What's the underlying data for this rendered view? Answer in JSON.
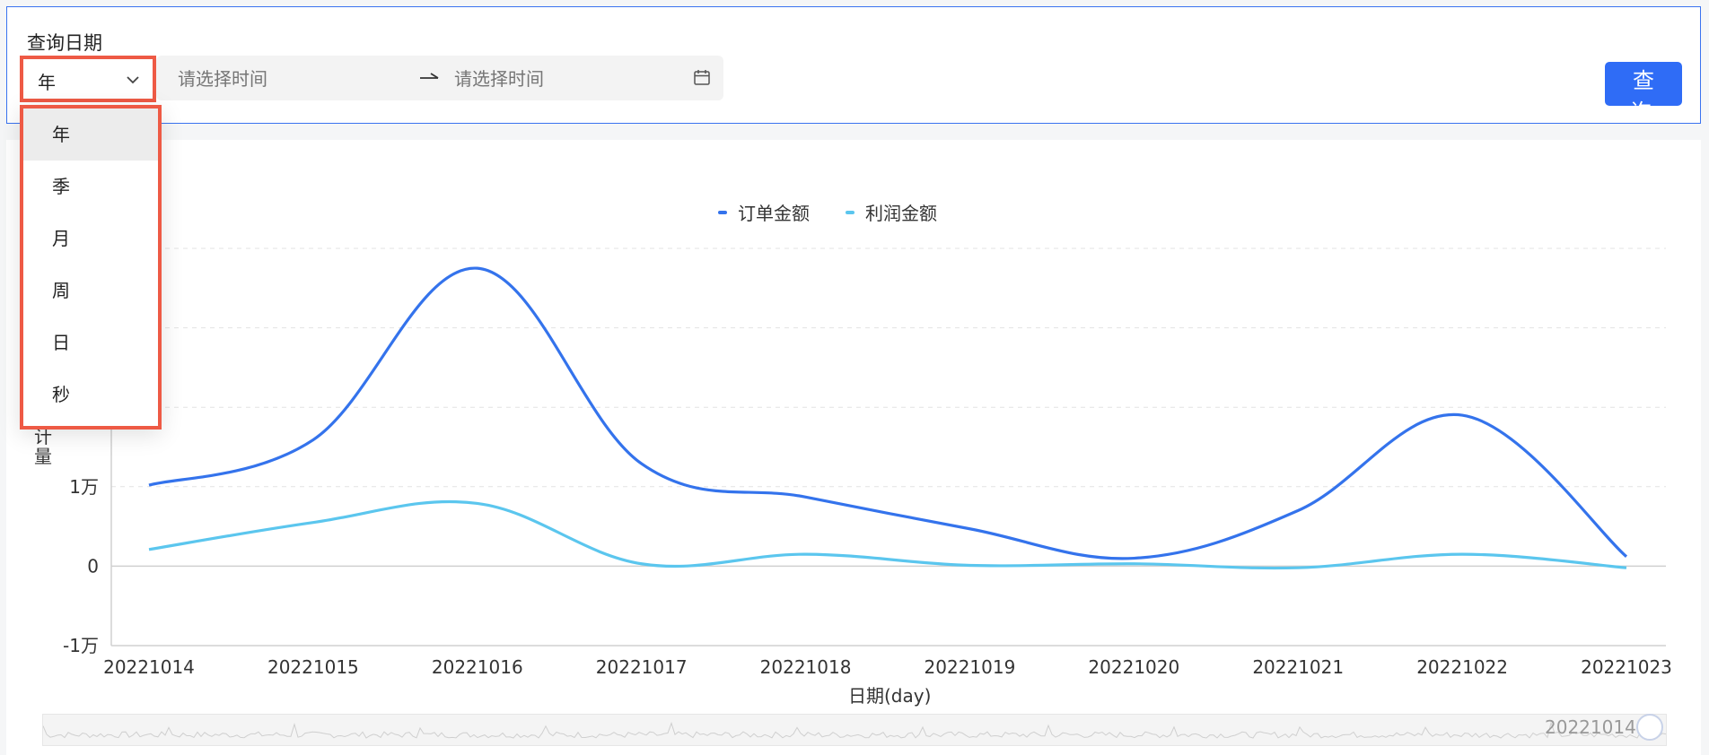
{
  "query": {
    "label": "查询日期",
    "granularity": "年",
    "start_placeholder": "请选择时间",
    "end_placeholder": "请选择时间",
    "submit_label": "查 询"
  },
  "dropdown": {
    "items": [
      "年",
      "季",
      "月",
      "周",
      "日",
      "秒"
    ],
    "active_index": 0
  },
  "colors": {
    "accent": "#2f6cf6",
    "highlight": "#ee5a45",
    "series_order": "#3473ec",
    "series_profit": "#5bc6ee"
  },
  "icons": {
    "select_arrow": "chevron-down-icon",
    "range_separator": "arrow-right-icon",
    "calendar": "calendar-icon"
  },
  "chart_data": {
    "type": "line",
    "categories": [
      "20221014",
      "20221015",
      "20221016",
      "20221017",
      "20221018",
      "20221019",
      "20221020",
      "20221021",
      "20221022",
      "20221023"
    ],
    "series": [
      {
        "name": "订单金额",
        "values": [
          10200,
          15900,
          37500,
          12900,
          8700,
          4700,
          1000,
          7000,
          19000,
          1200
        ]
      },
      {
        "name": "利润金额",
        "values": [
          2100,
          5500,
          7900,
          300,
          1500,
          100,
          300,
          -200,
          1500,
          -200
        ]
      }
    ],
    "xlabel": "日期(day)",
    "ylabel": "计量",
    "ylim": [
      -10000,
      40000
    ],
    "yticks_labeled": [
      {
        "value": 10000,
        "label": "1万"
      },
      {
        "value": 0,
        "label": "0"
      },
      {
        "value": -10000,
        "label": "-1万"
      }
    ],
    "grid": true,
    "legend": "top-center",
    "smooth": true
  },
  "zoom": {
    "label": "20221014"
  }
}
